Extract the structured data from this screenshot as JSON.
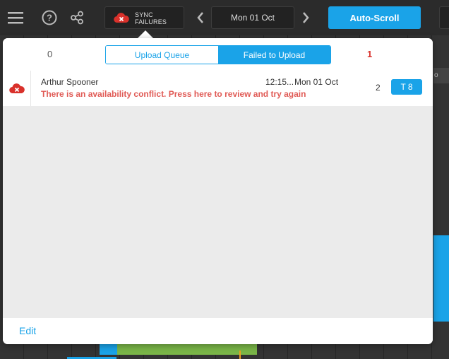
{
  "topbar": {
    "menu_icon": "hamburger-icon",
    "help_icon": "question-circle-icon",
    "share_icon": "share-nodes-icon",
    "sync_line1": "SYNC",
    "sync_line2": "FAILURES",
    "date": "Mon 01 Oct",
    "autoscroll_label": "Auto-Scroll"
  },
  "popover": {
    "count_left": "0",
    "tabs": [
      "Upload Queue",
      "Failed to Upload"
    ],
    "active_tab": "Failed to Upload",
    "count_right": "1",
    "rows": [
      {
        "name": "Arthur Spooner",
        "time": "12:15...",
        "date": "Mon 01 Oct",
        "message": "There is an availability conflict. Press here to review and try again",
        "count": "2",
        "tag": "T 8"
      }
    ],
    "edit_label": "Edit"
  },
  "colors": {
    "accent": "#1aa3e8",
    "error": "#d9312b",
    "error_text": "#e05a55"
  }
}
